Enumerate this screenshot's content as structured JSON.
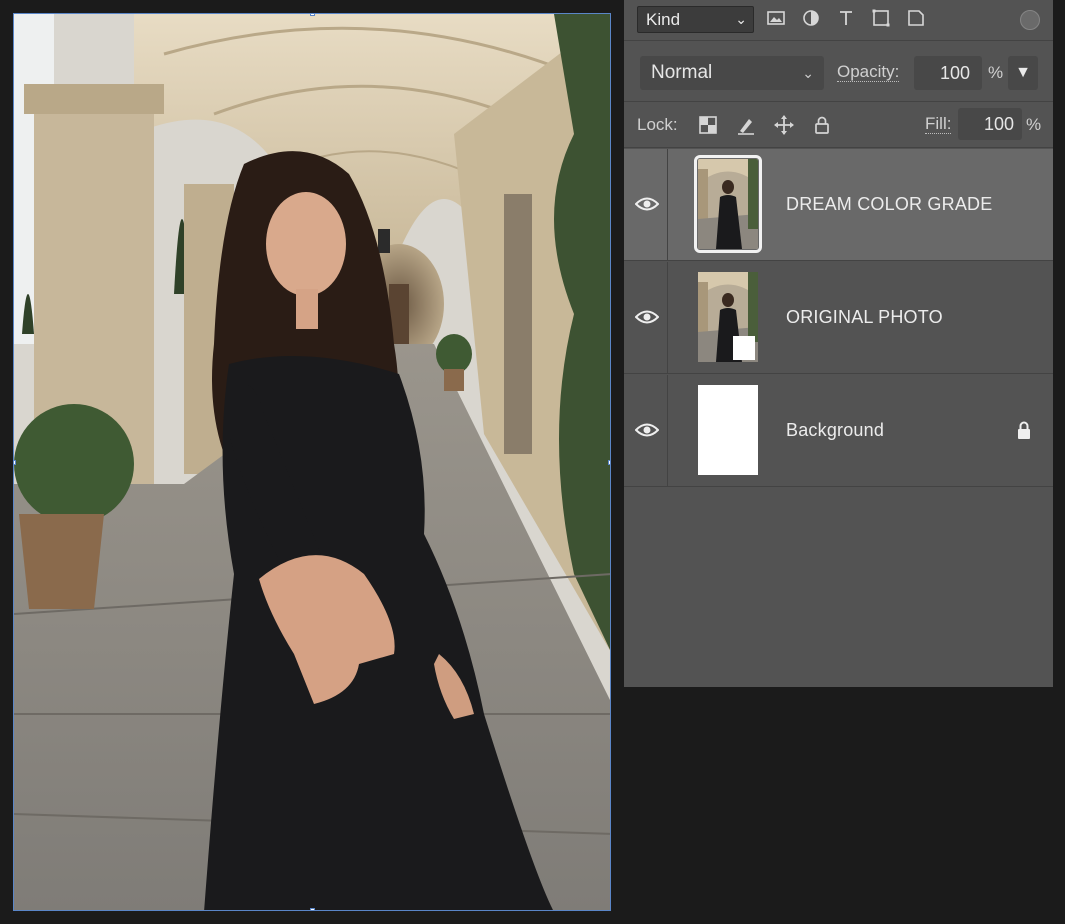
{
  "layers_panel": {
    "filter": {
      "kind_label": "Kind",
      "icons": [
        "image-filter-icon",
        "adjustment-filter-icon",
        "type-filter-icon",
        "shape-filter-icon",
        "smart-object-filter-icon"
      ]
    },
    "blend_mode": "Normal",
    "opacity_label": "Opacity:",
    "opacity_value": "100",
    "opacity_unit": "%",
    "lock_label": "Lock:",
    "lock_icons": [
      "lock-transparent-pixels-icon",
      "lock-image-pixels-icon",
      "lock-position-icon",
      "lock-all-icon"
    ],
    "fill_label": "Fill:",
    "fill_value": "100",
    "fill_unit": "%",
    "layers": [
      {
        "name": "DREAM COLOR GRADE",
        "visible": true,
        "selected": true,
        "locked": false
      },
      {
        "name": "ORIGINAL PHOTO",
        "visible": true,
        "selected": false,
        "locked": false
      },
      {
        "name": "Background",
        "visible": true,
        "selected": false,
        "locked": true
      }
    ]
  },
  "colors": {
    "panel_bg": "#535353",
    "selected_row": "#696969",
    "app_bg": "#1b1b1b",
    "selection_border": "#5a86c8"
  }
}
